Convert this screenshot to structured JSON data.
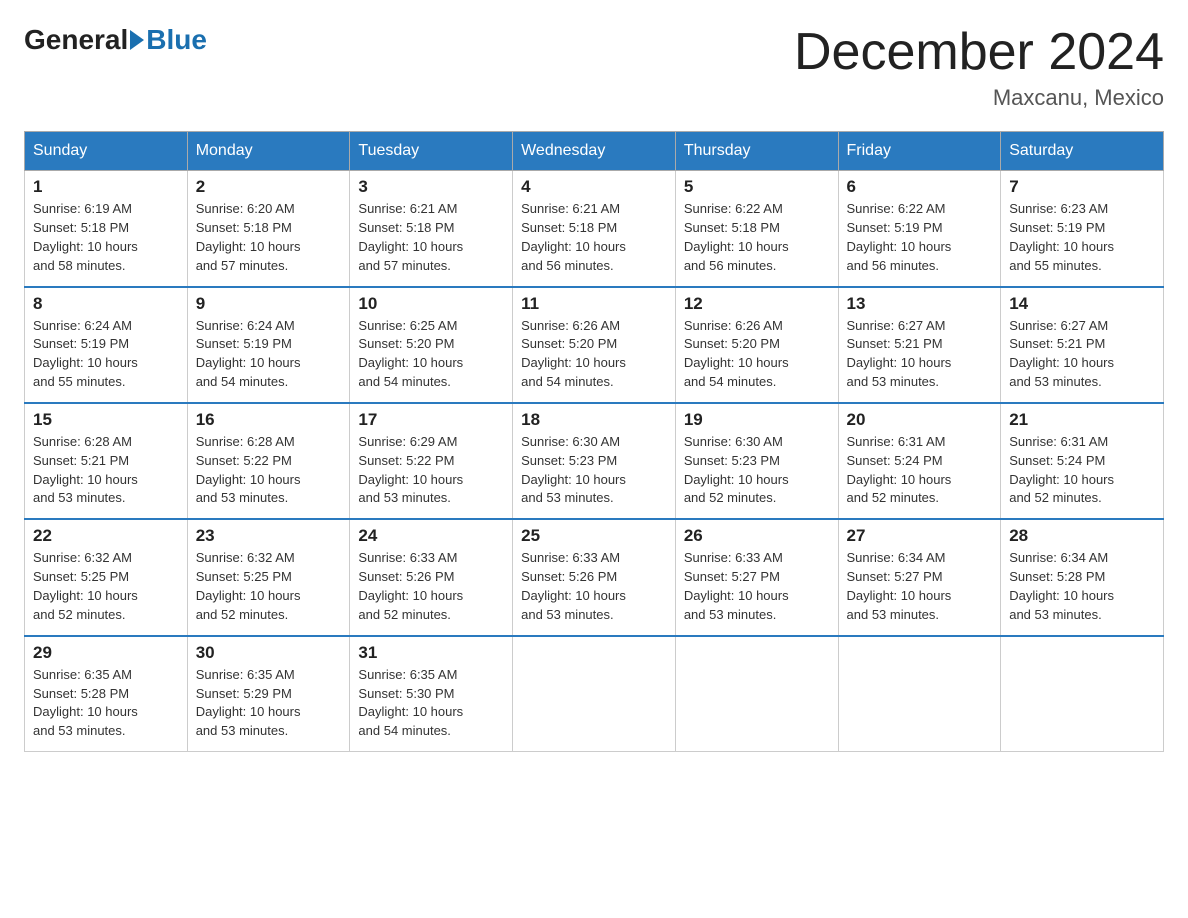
{
  "header": {
    "logo_general": "General",
    "logo_blue": "Blue",
    "month_title": "December 2024",
    "location": "Maxcanu, Mexico"
  },
  "days_of_week": [
    "Sunday",
    "Monday",
    "Tuesday",
    "Wednesday",
    "Thursday",
    "Friday",
    "Saturday"
  ],
  "weeks": [
    [
      {
        "day": "1",
        "sunrise": "6:19 AM",
        "sunset": "5:18 PM",
        "daylight": "10 hours and 58 minutes."
      },
      {
        "day": "2",
        "sunrise": "6:20 AM",
        "sunset": "5:18 PM",
        "daylight": "10 hours and 57 minutes."
      },
      {
        "day": "3",
        "sunrise": "6:21 AM",
        "sunset": "5:18 PM",
        "daylight": "10 hours and 57 minutes."
      },
      {
        "day": "4",
        "sunrise": "6:21 AM",
        "sunset": "5:18 PM",
        "daylight": "10 hours and 56 minutes."
      },
      {
        "day": "5",
        "sunrise": "6:22 AM",
        "sunset": "5:18 PM",
        "daylight": "10 hours and 56 minutes."
      },
      {
        "day": "6",
        "sunrise": "6:22 AM",
        "sunset": "5:19 PM",
        "daylight": "10 hours and 56 minutes."
      },
      {
        "day": "7",
        "sunrise": "6:23 AM",
        "sunset": "5:19 PM",
        "daylight": "10 hours and 55 minutes."
      }
    ],
    [
      {
        "day": "8",
        "sunrise": "6:24 AM",
        "sunset": "5:19 PM",
        "daylight": "10 hours and 55 minutes."
      },
      {
        "day": "9",
        "sunrise": "6:24 AM",
        "sunset": "5:19 PM",
        "daylight": "10 hours and 54 minutes."
      },
      {
        "day": "10",
        "sunrise": "6:25 AM",
        "sunset": "5:20 PM",
        "daylight": "10 hours and 54 minutes."
      },
      {
        "day": "11",
        "sunrise": "6:26 AM",
        "sunset": "5:20 PM",
        "daylight": "10 hours and 54 minutes."
      },
      {
        "day": "12",
        "sunrise": "6:26 AM",
        "sunset": "5:20 PM",
        "daylight": "10 hours and 54 minutes."
      },
      {
        "day": "13",
        "sunrise": "6:27 AM",
        "sunset": "5:21 PM",
        "daylight": "10 hours and 53 minutes."
      },
      {
        "day": "14",
        "sunrise": "6:27 AM",
        "sunset": "5:21 PM",
        "daylight": "10 hours and 53 minutes."
      }
    ],
    [
      {
        "day": "15",
        "sunrise": "6:28 AM",
        "sunset": "5:21 PM",
        "daylight": "10 hours and 53 minutes."
      },
      {
        "day": "16",
        "sunrise": "6:28 AM",
        "sunset": "5:22 PM",
        "daylight": "10 hours and 53 minutes."
      },
      {
        "day": "17",
        "sunrise": "6:29 AM",
        "sunset": "5:22 PM",
        "daylight": "10 hours and 53 minutes."
      },
      {
        "day": "18",
        "sunrise": "6:30 AM",
        "sunset": "5:23 PM",
        "daylight": "10 hours and 53 minutes."
      },
      {
        "day": "19",
        "sunrise": "6:30 AM",
        "sunset": "5:23 PM",
        "daylight": "10 hours and 52 minutes."
      },
      {
        "day": "20",
        "sunrise": "6:31 AM",
        "sunset": "5:24 PM",
        "daylight": "10 hours and 52 minutes."
      },
      {
        "day": "21",
        "sunrise": "6:31 AM",
        "sunset": "5:24 PM",
        "daylight": "10 hours and 52 minutes."
      }
    ],
    [
      {
        "day": "22",
        "sunrise": "6:32 AM",
        "sunset": "5:25 PM",
        "daylight": "10 hours and 52 minutes."
      },
      {
        "day": "23",
        "sunrise": "6:32 AM",
        "sunset": "5:25 PM",
        "daylight": "10 hours and 52 minutes."
      },
      {
        "day": "24",
        "sunrise": "6:33 AM",
        "sunset": "5:26 PM",
        "daylight": "10 hours and 52 minutes."
      },
      {
        "day": "25",
        "sunrise": "6:33 AM",
        "sunset": "5:26 PM",
        "daylight": "10 hours and 53 minutes."
      },
      {
        "day": "26",
        "sunrise": "6:33 AM",
        "sunset": "5:27 PM",
        "daylight": "10 hours and 53 minutes."
      },
      {
        "day": "27",
        "sunrise": "6:34 AM",
        "sunset": "5:27 PM",
        "daylight": "10 hours and 53 minutes."
      },
      {
        "day": "28",
        "sunrise": "6:34 AM",
        "sunset": "5:28 PM",
        "daylight": "10 hours and 53 minutes."
      }
    ],
    [
      {
        "day": "29",
        "sunrise": "6:35 AM",
        "sunset": "5:28 PM",
        "daylight": "10 hours and 53 minutes."
      },
      {
        "day": "30",
        "sunrise": "6:35 AM",
        "sunset": "5:29 PM",
        "daylight": "10 hours and 53 minutes."
      },
      {
        "day": "31",
        "sunrise": "6:35 AM",
        "sunset": "5:30 PM",
        "daylight": "10 hours and 54 minutes."
      },
      null,
      null,
      null,
      null
    ]
  ],
  "labels": {
    "sunrise": "Sunrise:",
    "sunset": "Sunset:",
    "daylight": "Daylight:"
  }
}
